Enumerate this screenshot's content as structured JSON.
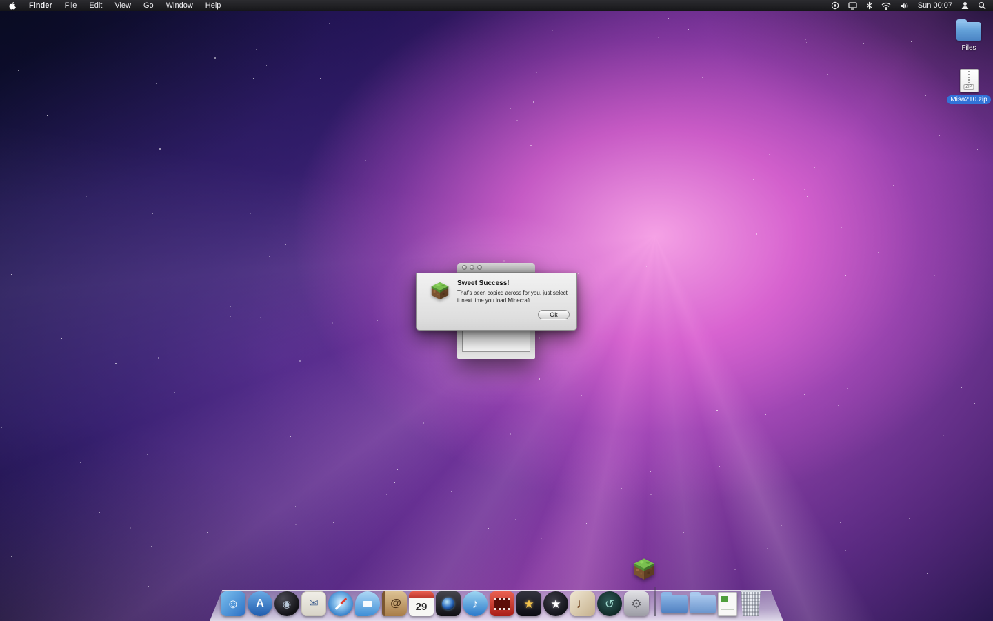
{
  "menu_bar": {
    "items": [
      "Finder",
      "File",
      "Edit",
      "View",
      "Go",
      "Window",
      "Help"
    ],
    "clock": "Sun 00:07",
    "status_icons": [
      "universal-access",
      "display",
      "bluetooth",
      "wifi",
      "volume",
      "user",
      "spotlight"
    ]
  },
  "desktop_icons": {
    "files_label": "Files",
    "zip_label": "Misa210.zip",
    "zip_badge": "ZIP"
  },
  "dialog": {
    "heading": "Sweet Success!",
    "body": "That's been copied across for you, just select it next time you load Minecraft.",
    "ok_label": "Ok",
    "icon": "minecraft-grass-block"
  },
  "dock": {
    "items": [
      {
        "name": "finder",
        "kind": "finder",
        "glyph": "☺"
      },
      {
        "name": "app-store",
        "kind": "appstore",
        "glyph": "A"
      },
      {
        "name": "dashboard",
        "kind": "dashboard",
        "glyph": "◉"
      },
      {
        "name": "mail",
        "kind": "mail",
        "glyph": "✉"
      },
      {
        "name": "safari",
        "kind": "safari",
        "glyph": ""
      },
      {
        "name": "ichat",
        "kind": "ichat",
        "glyph": ""
      },
      {
        "name": "address-book",
        "kind": "addressbook",
        "glyph": "@"
      },
      {
        "name": "ical",
        "kind": "ical",
        "glyph": "29"
      },
      {
        "name": "photo-booth",
        "kind": "photobooth",
        "glyph": ""
      },
      {
        "name": "itunes",
        "kind": "itunes",
        "glyph": "♪"
      },
      {
        "name": "dvd-player",
        "kind": "dvd",
        "glyph": ""
      },
      {
        "name": "idvd",
        "kind": "idvd",
        "glyph": "★"
      },
      {
        "name": "aperture",
        "kind": "aperture",
        "glyph": "★"
      },
      {
        "name": "garageband",
        "kind": "garageband",
        "glyph": "♩"
      },
      {
        "name": "time-machine",
        "kind": "timemachine",
        "glyph": "↺"
      },
      {
        "name": "system-preferences",
        "kind": "sysprefs",
        "glyph": "⚙"
      },
      {
        "name": "separator",
        "kind": "separator",
        "glyph": ""
      },
      {
        "name": "stack-folder-1",
        "kind": "folder",
        "glyph": ""
      },
      {
        "name": "stack-folder-2",
        "kind": "folder2",
        "glyph": ""
      },
      {
        "name": "stack-documents",
        "kind": "document",
        "glyph": ""
      },
      {
        "name": "trash",
        "kind": "trash",
        "glyph": ""
      }
    ],
    "bounce_icon": "minecraft-grass-block"
  },
  "colors": {
    "selection_blue": "#3273d8",
    "wallpaper_pink": "#e06ad0",
    "wallpaper_navy": "#150f38",
    "menubar_dark": "#1c1c20"
  }
}
